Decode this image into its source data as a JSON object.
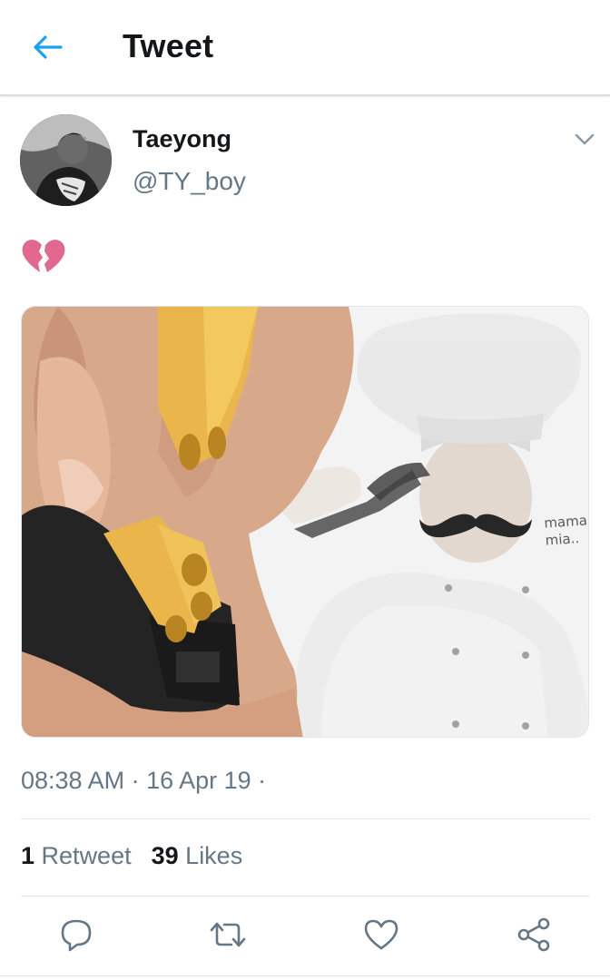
{
  "header": {
    "title": "Tweet",
    "back_icon": "back-arrow-icon",
    "accent_color": "#1da1f2"
  },
  "tweet": {
    "author": {
      "display_name": "Taeyong",
      "handle": "@TY_boy"
    },
    "text_emoji": "💔",
    "media": {
      "caption": [
        "mama",
        "mia.."
      ]
    },
    "timestamp": "08:38 AM · 16 Apr 19 ·",
    "stats": {
      "retweets_count": "1",
      "retweets_label": "Retweet",
      "likes_count": "39",
      "likes_label": "Likes"
    },
    "actions": [
      "reply-icon",
      "retweet-icon",
      "like-icon",
      "share-icon"
    ]
  }
}
